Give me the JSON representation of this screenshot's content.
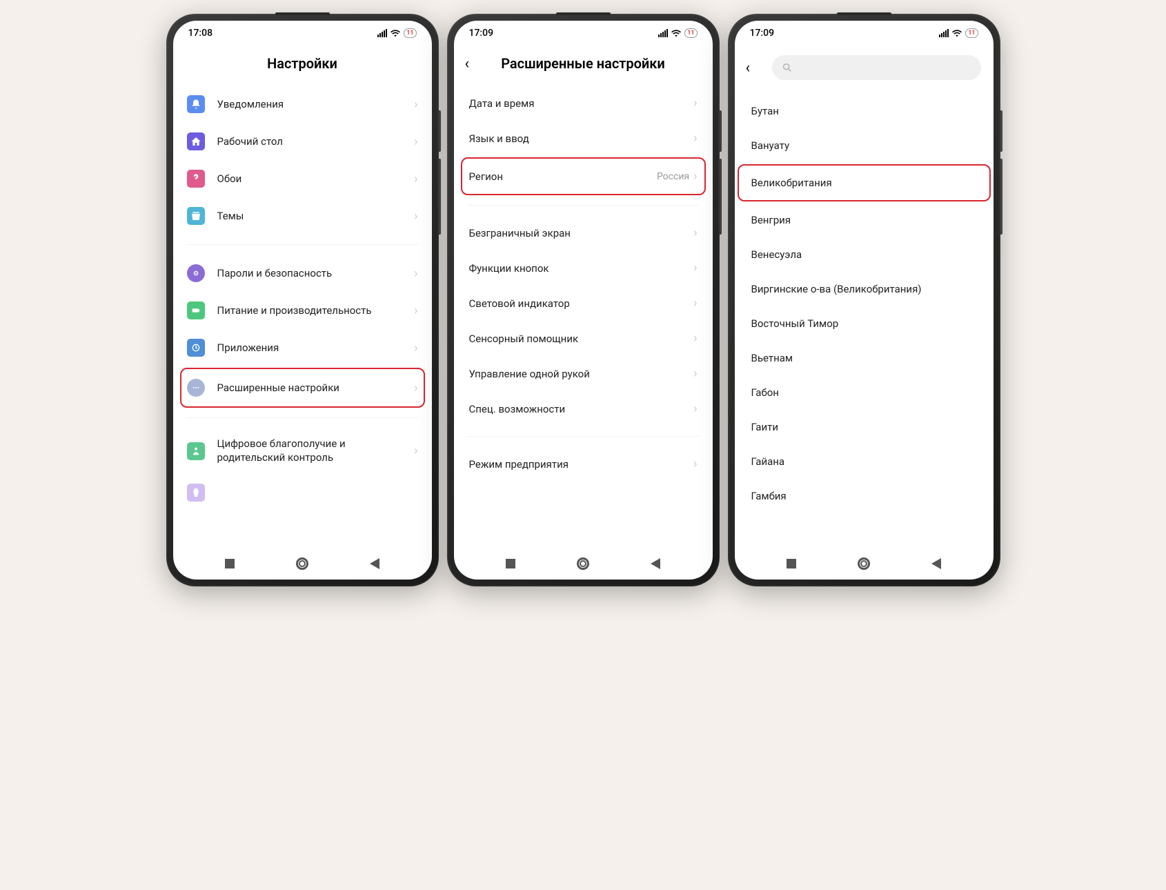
{
  "status": {
    "time_a": "17:08",
    "time_b": "17:09",
    "time_c": "17:09",
    "battery": "11"
  },
  "screen_a": {
    "title": "Настройки",
    "items1": [
      {
        "label": "Уведомления"
      },
      {
        "label": "Рабочий стол"
      },
      {
        "label": "Обои"
      },
      {
        "label": "Темы"
      }
    ],
    "items2": [
      {
        "label": "Пароли и безопасность"
      },
      {
        "label": "Питание и производительность"
      },
      {
        "label": "Приложения"
      },
      {
        "label": "Расширенные настройки",
        "highlight": true
      }
    ],
    "items3": [
      {
        "label": "Цифровое благополучие и родительский контроль"
      }
    ]
  },
  "screen_b": {
    "title": "Расширенные настройки",
    "group1": [
      {
        "label": "Дата и время"
      },
      {
        "label": "Язык и ввод"
      },
      {
        "label": "Регион",
        "value": "Россия",
        "highlight": true
      }
    ],
    "group2": [
      {
        "label": "Безграничный экран"
      },
      {
        "label": "Функции кнопок"
      },
      {
        "label": "Световой индикатор"
      },
      {
        "label": "Сенсорный помощник"
      },
      {
        "label": "Управление одной рукой"
      },
      {
        "label": "Спец. возможности"
      }
    ],
    "group3": [
      {
        "label": "Режим предприятия"
      }
    ]
  },
  "screen_c": {
    "countries": [
      "Бутан",
      "Вануату",
      "Великобритания",
      "Венгрия",
      "Венесуэла",
      "Виргинские о-ва (Великобритания)",
      "Восточный Тимор",
      "Вьетнам",
      "Габон",
      "Гаити",
      "Гайана",
      "Гамбия"
    ],
    "highlight_index": 2
  }
}
